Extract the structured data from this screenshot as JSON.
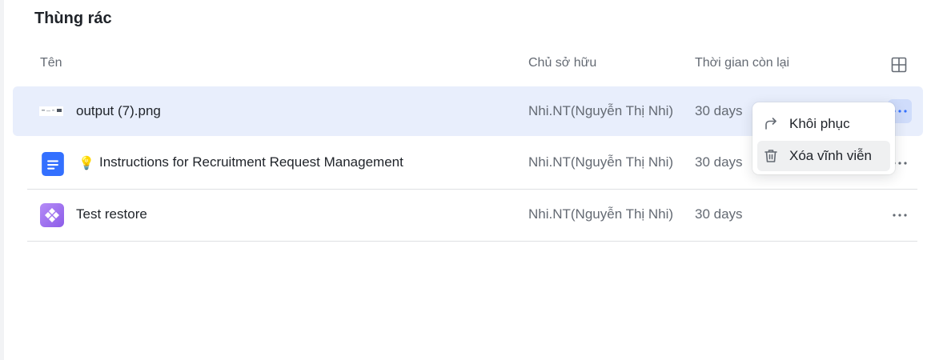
{
  "page": {
    "title": "Thùng rác"
  },
  "table": {
    "headers": {
      "name": "Tên",
      "owner": "Chủ sở hữu",
      "time_left": "Thời gian còn lại"
    },
    "rows": [
      {
        "name": "output (7).png",
        "owner": "Nhi.NT(Nguyễn Thị Nhi)",
        "time_left": "30 days",
        "icon": "image-thumbnail-icon"
      },
      {
        "emoji": "💡",
        "name": "Instructions for Recruitment Request Management",
        "owner": "Nhi.NT(Nguyễn Thị Nhi)",
        "time_left": "30 days",
        "icon": "document-icon"
      },
      {
        "name": "Test restore",
        "owner": "Nhi.NT(Nguyễn Thị Nhi)",
        "time_left": "30 days",
        "icon": "base-app-icon"
      }
    ]
  },
  "context_menu": {
    "items": [
      {
        "label": "Khôi phục",
        "icon": "restore-icon"
      },
      {
        "label": "Xóa vĩnh viễn",
        "icon": "trash-icon"
      }
    ]
  },
  "colors": {
    "selected_row": "#e8eefc",
    "doc_blue": "#3370ff",
    "app_purple": "#9f6fee"
  }
}
